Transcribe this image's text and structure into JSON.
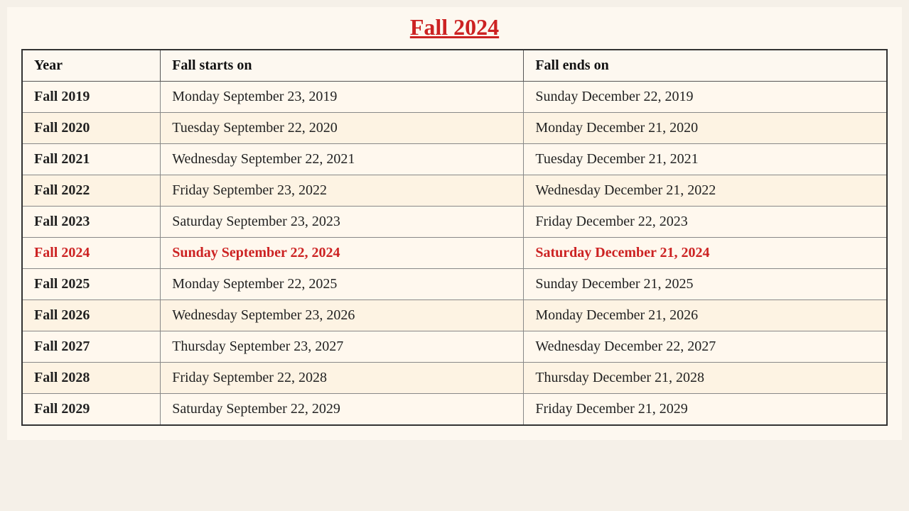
{
  "title": "Fall 2024",
  "table": {
    "headers": [
      "Year",
      "Fall starts on",
      "Fall ends on"
    ],
    "rows": [
      {
        "year": "Fall 2019",
        "start": "Monday September 23, 2019",
        "end": "Sunday December 22, 2019",
        "highlight": false
      },
      {
        "year": "Fall 2020",
        "start": "Tuesday September 22, 2020",
        "end": "Monday December 21, 2020",
        "highlight": false
      },
      {
        "year": "Fall 2021",
        "start": "Wednesday September 22, 2021",
        "end": "Tuesday December 21, 2021",
        "highlight": false
      },
      {
        "year": "Fall 2022",
        "start": "Friday September 23, 2022",
        "end": "Wednesday December 21, 2022",
        "highlight": false
      },
      {
        "year": "Fall 2023",
        "start": "Saturday September 23, 2023",
        "end": "Friday December 22, 2023",
        "highlight": false
      },
      {
        "year": "Fall 2024",
        "start": "Sunday September 22, 2024",
        "end": "Saturday December 21, 2024",
        "highlight": true
      },
      {
        "year": "Fall 2025",
        "start": "Monday September 22, 2025",
        "end": "Sunday December 21, 2025",
        "highlight": false
      },
      {
        "year": "Fall 2026",
        "start": "Wednesday September 23, 2026",
        "end": "Monday December 21, 2026",
        "highlight": false
      },
      {
        "year": "Fall 2027",
        "start": "Thursday September 23, 2027",
        "end": "Wednesday December 22, 2027",
        "highlight": false
      },
      {
        "year": "Fall 2028",
        "start": "Friday September 22, 2028",
        "end": "Thursday December 21, 2028",
        "highlight": false
      },
      {
        "year": "Fall 2029",
        "start": "Saturday September 22, 2029",
        "end": "Friday December 21, 2029",
        "highlight": false
      }
    ]
  }
}
